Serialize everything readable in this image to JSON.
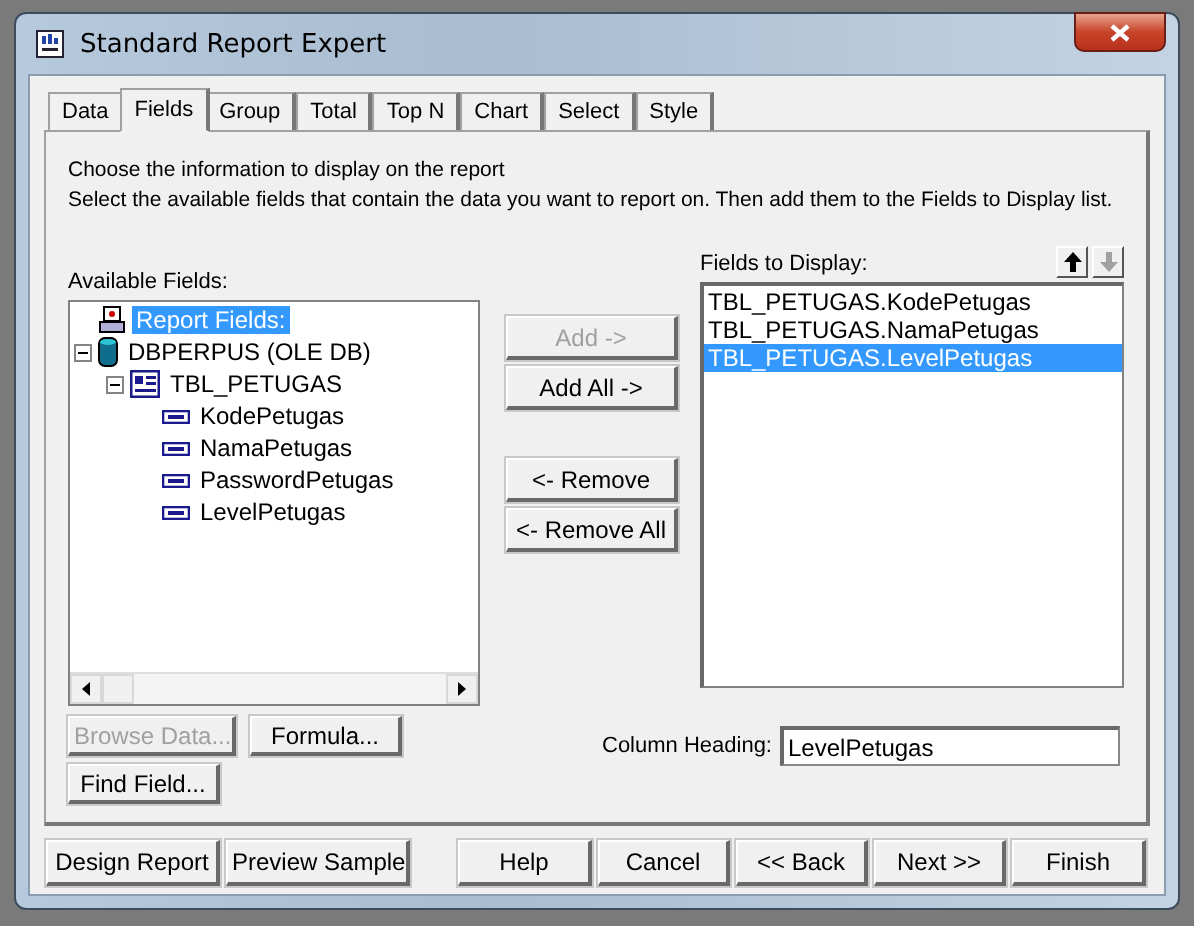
{
  "window": {
    "title": "Standard Report Expert"
  },
  "tabs": [
    {
      "label": "Data",
      "selected": false
    },
    {
      "label": "Fields",
      "selected": true
    },
    {
      "label": "Group",
      "selected": false
    },
    {
      "label": "Total",
      "selected": false
    },
    {
      "label": "Top N",
      "selected": false
    },
    {
      "label": "Chart",
      "selected": false
    },
    {
      "label": "Select",
      "selected": false
    },
    {
      "label": "Style",
      "selected": false
    }
  ],
  "instructions": [
    "Choose the information to display on the report",
    "Select the available fields that contain the data you want to report on.  Then add them to the Fields to Display list."
  ],
  "available_fields": {
    "label": "Available Fields:",
    "tree": [
      {
        "label": "Report Fields:",
        "kind": "report",
        "selected": true
      },
      {
        "label": "DBPERPUS (OLE DB)",
        "kind": "database",
        "selected": false,
        "expanded": true,
        "children": [
          {
            "label": "TBL_PETUGAS",
            "kind": "table",
            "selected": false,
            "expanded": true,
            "children": [
              {
                "label": "KodePetugas",
                "kind": "field",
                "selected": false
              },
              {
                "label": "NamaPetugas",
                "kind": "field",
                "selected": false
              },
              {
                "label": "PasswordPetugas",
                "kind": "field",
                "selected": false
              },
              {
                "label": "LevelPetugas",
                "kind": "field",
                "selected": false
              }
            ]
          }
        ]
      }
    ]
  },
  "move_buttons": [
    {
      "label": "Add ->",
      "disabled": true
    },
    {
      "label": "Add All ->",
      "disabled": false
    },
    {
      "label": "<- Remove",
      "disabled": false
    },
    {
      "label": "<- Remove All",
      "disabled": false
    }
  ],
  "fields_to_display": {
    "label": "Fields to Display:",
    "move_up_disabled": false,
    "move_down_disabled": true,
    "items": [
      {
        "label": "TBL_PETUGAS.KodePetugas",
        "selected": false
      },
      {
        "label": "TBL_PETUGAS.NamaPetugas",
        "selected": false
      },
      {
        "label": "TBL_PETUGAS.LevelPetugas",
        "selected": true
      }
    ]
  },
  "field_buttons": [
    {
      "label": "Browse Data...",
      "disabled": true
    },
    {
      "label": "Formula...",
      "disabled": false
    },
    {
      "label": "Find Field...",
      "disabled": false
    }
  ],
  "column_heading": {
    "label": "Column Heading:",
    "value": "LevelPetugas"
  },
  "footer_buttons": [
    "Design Report",
    "Preview Sample",
    "Help",
    "Cancel",
    "<< Back",
    "Next >>",
    "Finish"
  ]
}
